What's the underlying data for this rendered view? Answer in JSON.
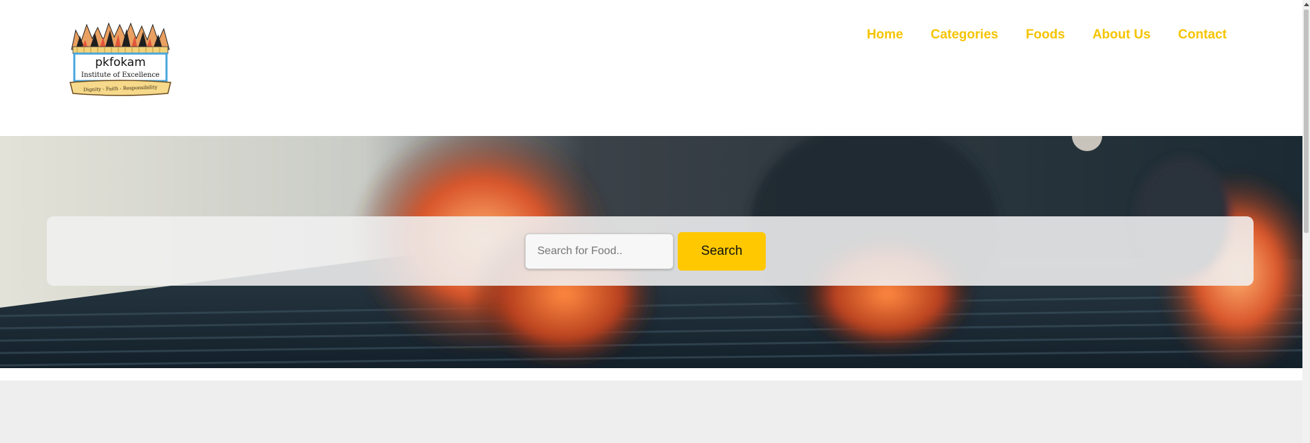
{
  "logo": {
    "name": "pkfokam",
    "subtitle": "Institute of Excellence",
    "motto": "Dignity - Faith - Responsibility"
  },
  "nav": {
    "items": [
      "Home",
      "Categories",
      "Foods",
      "About Us",
      "Contact"
    ]
  },
  "search": {
    "placeholder": "Search for Food..",
    "value": "",
    "button_label": "Search"
  },
  "colors": {
    "accent": "#ffc800",
    "nav_text": "#f5c400",
    "content_bg": "#eeeeee"
  },
  "hero": {
    "image": "grilled-meat-fire-photo"
  }
}
